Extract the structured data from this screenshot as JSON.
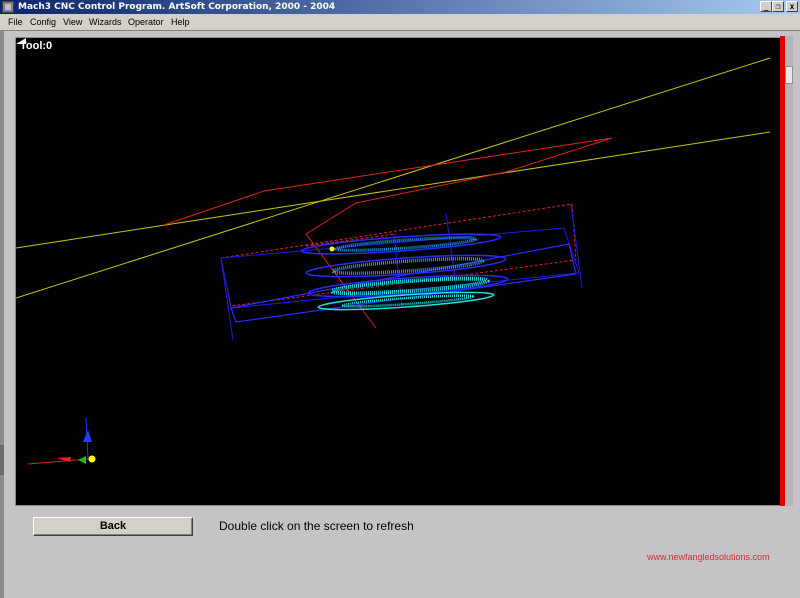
{
  "window": {
    "title": "Mach3 CNC Control Program.  ArtSoft Corporation, 2000 - 2004",
    "controls": {
      "minimize": "_",
      "restore": "❐",
      "close": "x"
    }
  },
  "menu": {
    "items": [
      "File",
      "Config",
      "View",
      "Wizards",
      "Operator",
      "Help"
    ]
  },
  "viewport": {
    "tool_label": "Tool:0",
    "background": "#000000",
    "colors": {
      "axis_lines": "#c8c800",
      "rapid_path": "#e02020",
      "extents_box": "#1a1ae8",
      "toolpath_outer": "#2a2aff",
      "toolpath_inner": "#1aa0ff",
      "toolpath_cyan": "#20e0e0",
      "tool_marker": "#ffff00",
      "gizmo_x": "#e02020",
      "gizmo_y": "#20c020",
      "gizmo_z": "#2040ff"
    }
  },
  "controls": {
    "back_label": "Back",
    "refresh_hint": "Double click on the screen to refresh"
  },
  "footer": {
    "url": "www.newfangledsolutions.com"
  }
}
